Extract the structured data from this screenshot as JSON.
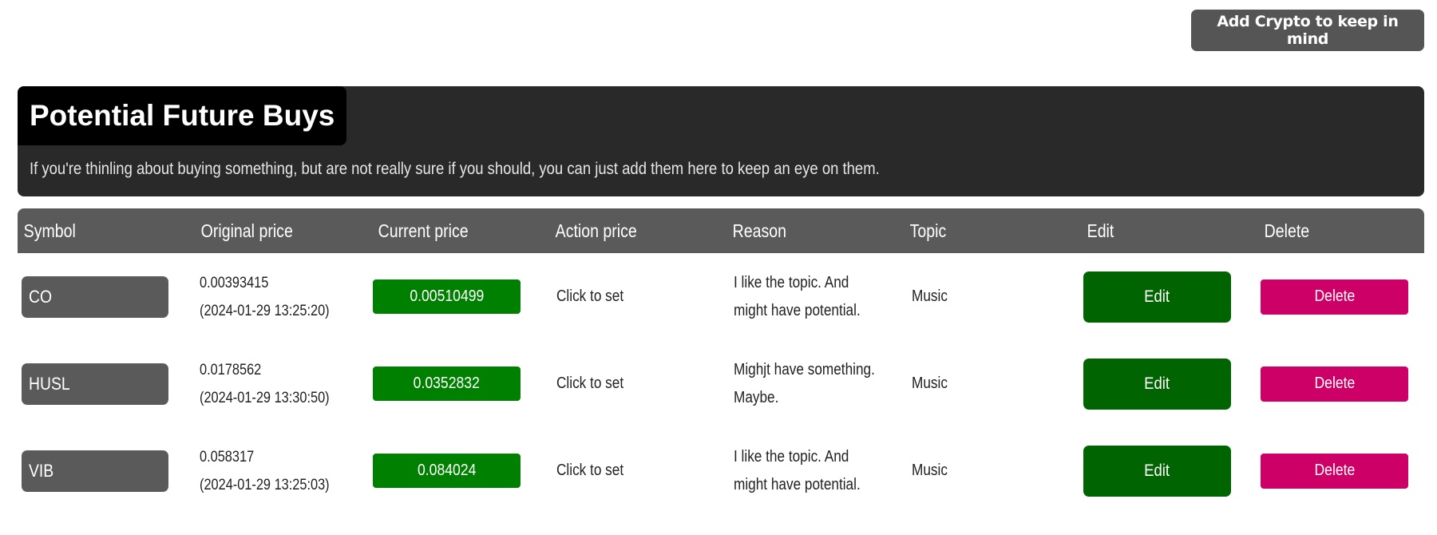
{
  "toolbar": {
    "add_label": "Add Crypto to keep in mind"
  },
  "intro": {
    "title": "Potential Future Buys",
    "description": "If you're thinling about buying something, but are not really sure if you should, you can just add them here to keep an eye on them."
  },
  "colors": {
    "intro_bg": "#292929",
    "title_bg": "#000000",
    "header_bg": "#5a5a5a",
    "current_price_bg": "#008000",
    "edit_bg": "#006400",
    "delete_bg": "#cc0066",
    "add_button_bg": "#555555"
  },
  "table": {
    "columns": [
      "Symbol",
      "Original price",
      "Current price",
      "Action price",
      "Reason",
      "Topic",
      "Edit",
      "Delete"
    ],
    "rows": [
      {
        "symbol": "CO",
        "original_price": "0.00393415",
        "original_time": "(2024-01-29 13:25:20)",
        "current_price": "0.00510499",
        "action_price": "Click to set",
        "reason": "I like the topic. And might have potential.",
        "topic": "Music",
        "edit_label": "Edit",
        "delete_label": "Delete"
      },
      {
        "symbol": "HUSL",
        "original_price": "0.0178562",
        "original_time": "(2024-01-29 13:30:50)",
        "current_price": "0.0352832",
        "action_price": "Click to set",
        "reason": "Mighjt have something. Maybe.",
        "topic": "Music",
        "edit_label": "Edit",
        "delete_label": "Delete"
      },
      {
        "symbol": "VIB",
        "original_price": "0.058317",
        "original_time": "(2024-01-29 13:25:03)",
        "current_price": "0.084024",
        "action_price": "Click to set",
        "reason": "I like the topic. And might have potential.",
        "topic": "Music",
        "edit_label": "Edit",
        "delete_label": "Delete"
      }
    ]
  }
}
